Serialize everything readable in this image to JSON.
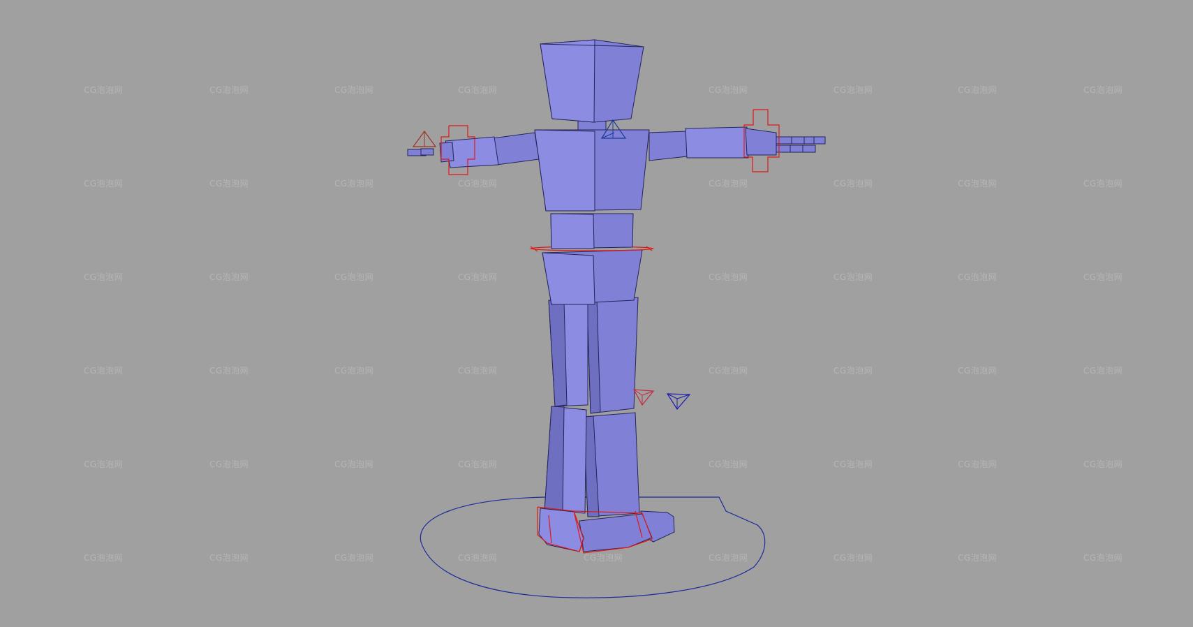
{
  "viewport": {
    "background": "#a0a0a0",
    "mesh_color": "#7f80d6",
    "selection_color": "#e01818",
    "control_color": "#1a2a9a"
  },
  "watermark": {
    "text": "CG泡泡网"
  },
  "model": {
    "parts": [
      "head",
      "neck",
      "chest",
      "abdomen",
      "pelvis",
      "left-upper-arm",
      "left-forearm",
      "left-hand",
      "right-upper-arm",
      "right-forearm",
      "right-hand",
      "left-thigh",
      "right-thigh",
      "left-shin",
      "right-shin",
      "left-foot",
      "right-foot"
    ],
    "controls": [
      "root-circle-control",
      "waist-ring-control",
      "left-wrist-control",
      "right-wrist-control",
      "left-ik-cone",
      "right-ik-cone",
      "neck-cone",
      "left-knee-target",
      "right-knee-target",
      "left-foot-control",
      "right-foot-control"
    ]
  }
}
